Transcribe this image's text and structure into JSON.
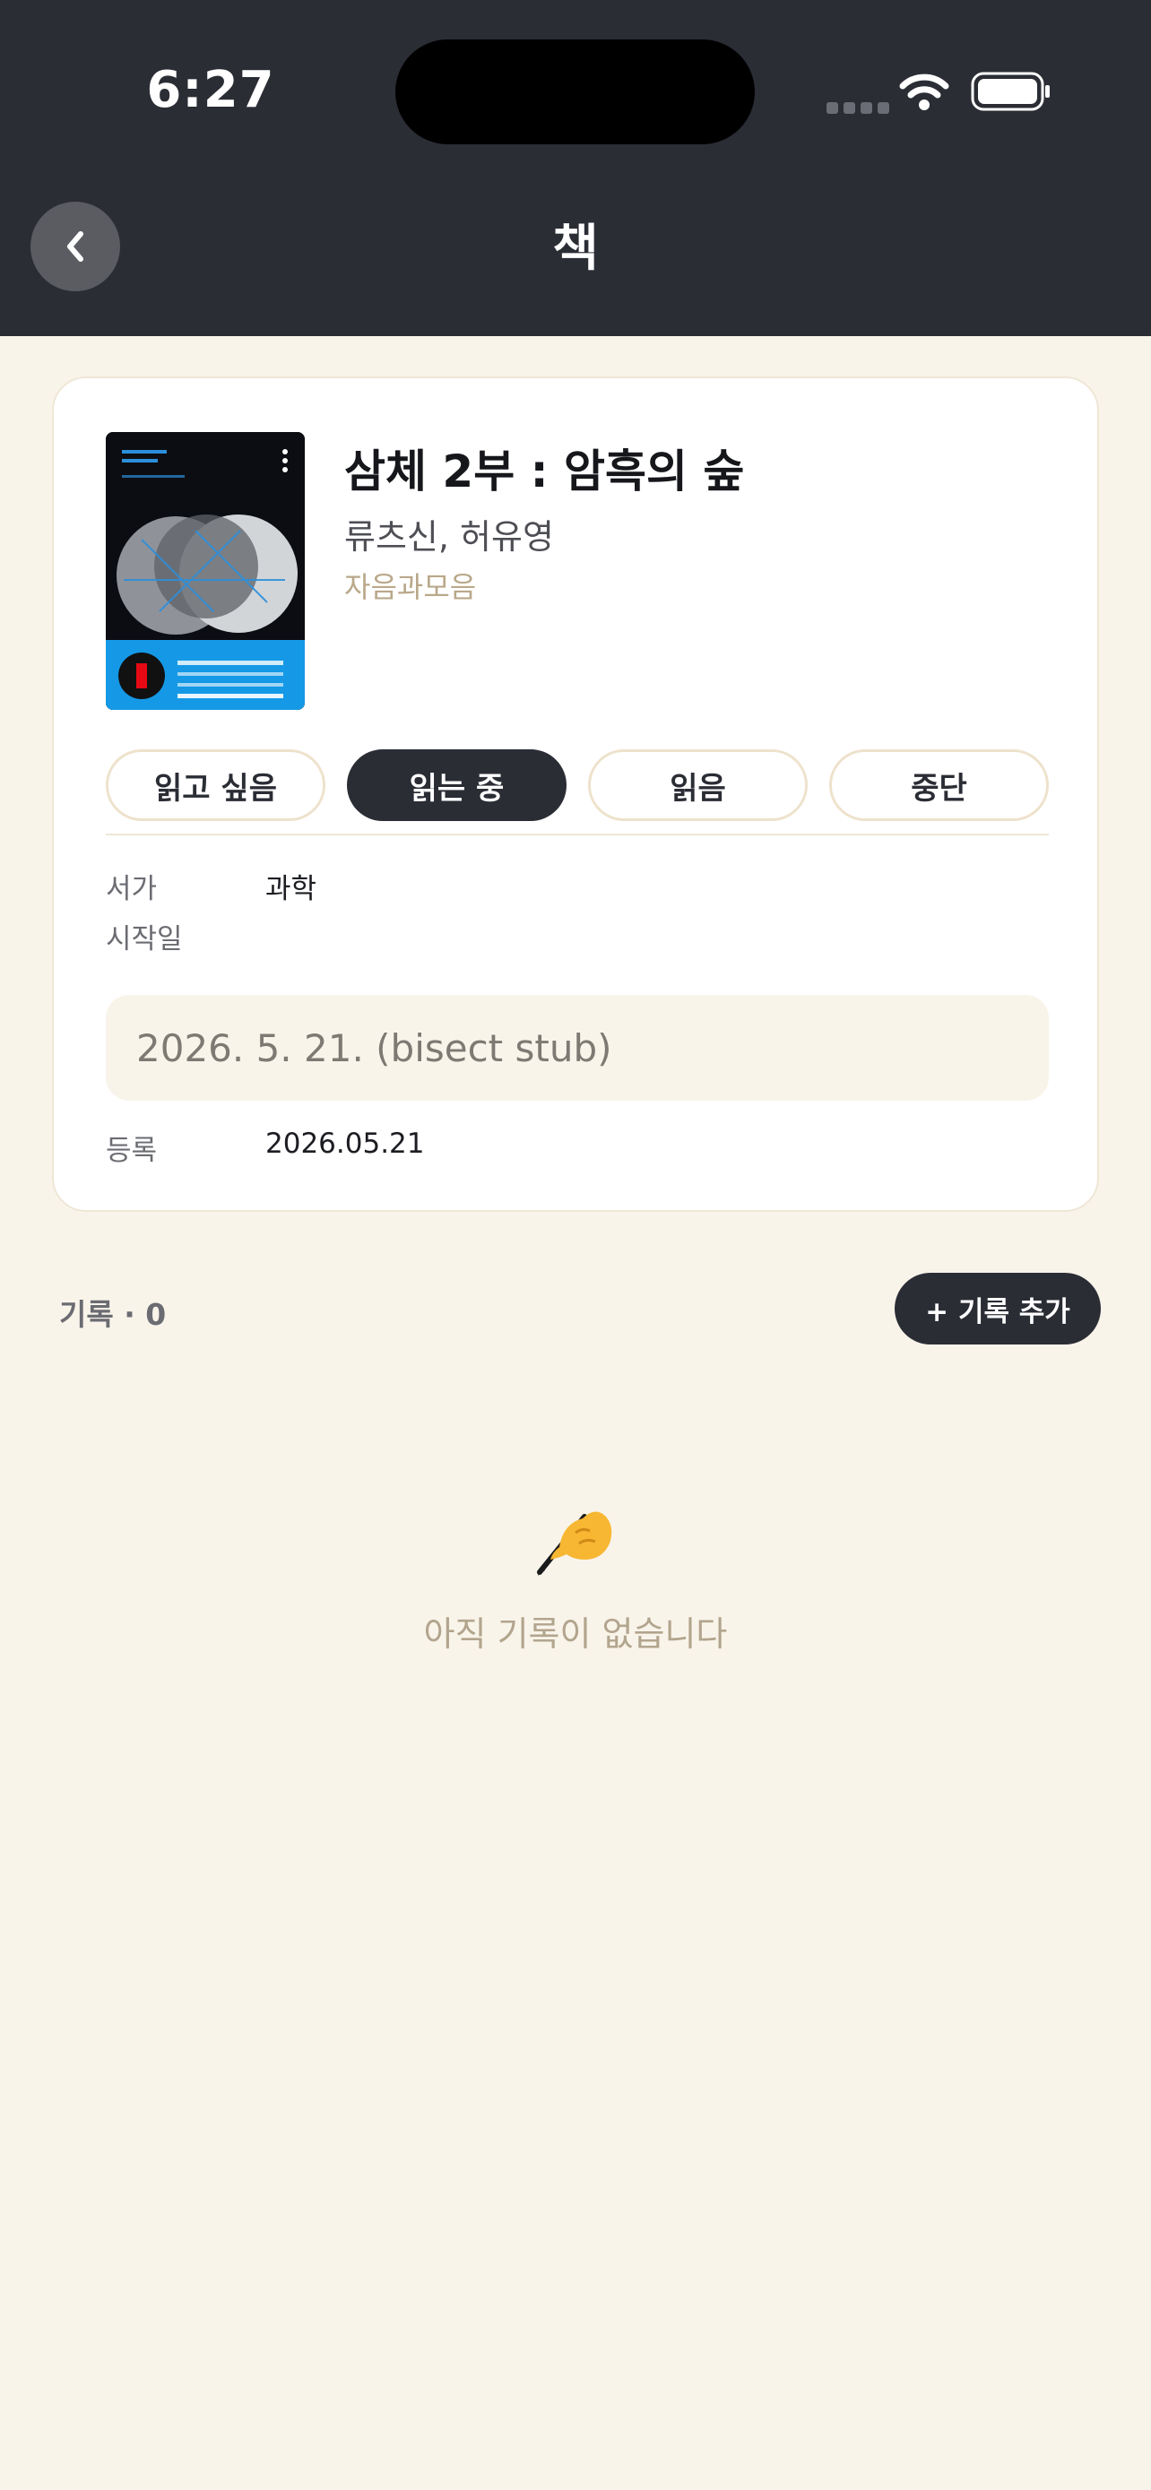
{
  "status_bar": {
    "time": "6:27"
  },
  "header": {
    "title": "책",
    "back_icon": "chevron-left-icon"
  },
  "book": {
    "title": "삼체 2부 : 암흑의 숲",
    "author": "류츠신, 허유영",
    "publisher": "자음과모음"
  },
  "status_options": [
    {
      "label": "읽고 싶음",
      "active": false
    },
    {
      "label": "읽는 중",
      "active": true
    },
    {
      "label": "읽음",
      "active": false
    },
    {
      "label": "중단",
      "active": false
    }
  ],
  "info": {
    "shelf_label": "서가",
    "shelf_value": "과학",
    "start_label": "시작일",
    "start_date": "2026. 5. 21. (bisect stub)",
    "registered_label": "등록",
    "registered_value": "2026.05.21"
  },
  "records": {
    "count_label": "기록 · 0",
    "add_button": "+ 기록 추가",
    "empty_icon": "writing-hand-icon",
    "empty_text": "아직 기록이 없습니다"
  },
  "colors": {
    "header_bg": "#2b2d35",
    "page_bg": "#f9f4ea",
    "accent_dark": "#2b2d35",
    "muted_tan": "#b9a88a"
  }
}
